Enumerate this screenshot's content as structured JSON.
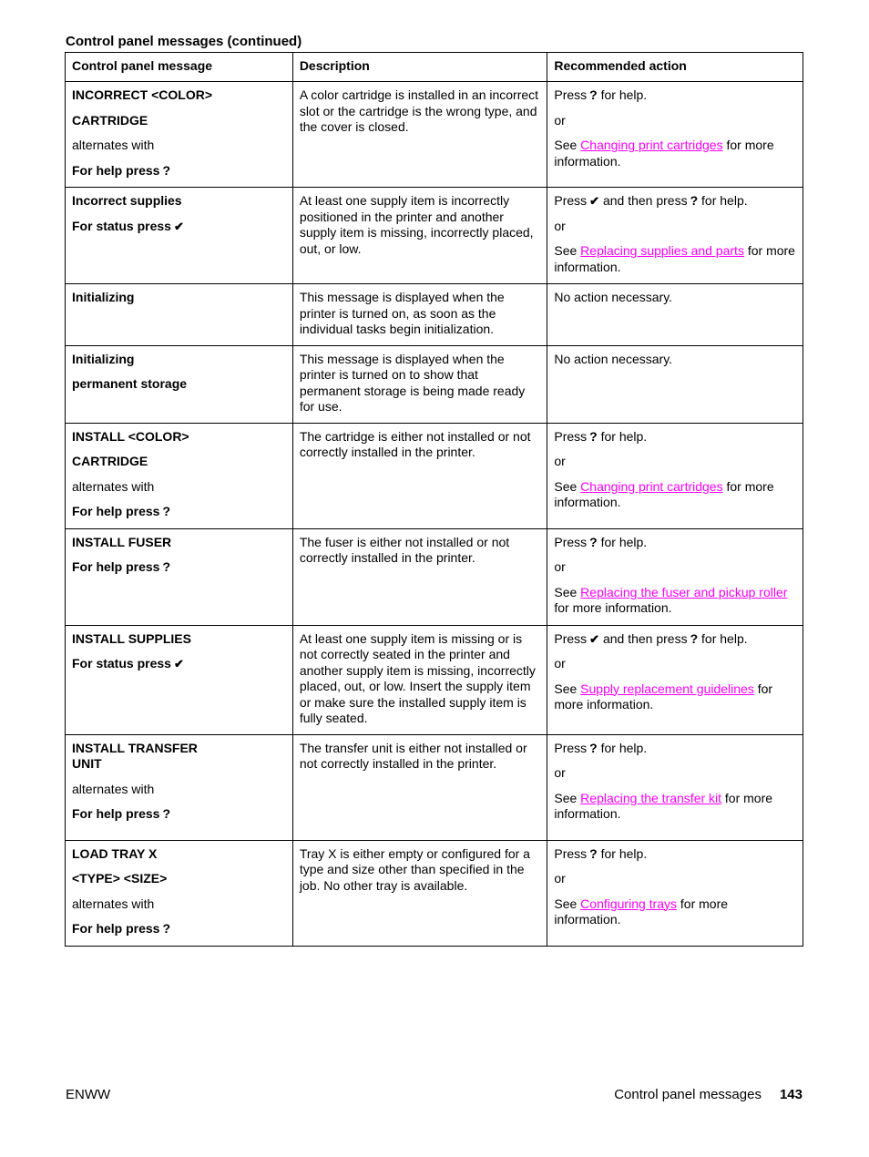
{
  "section_title": "Control panel messages (continued)",
  "table": {
    "headers": [
      "Control panel message",
      "Description",
      "Recommended action"
    ],
    "rows": [
      {
        "message": [
          "INCORRECT <COLOR>",
          "CARTRIDGE",
          "alternates with",
          "For help press"
        ],
        "description": "A color cartridge is installed in an incorrect slot or the cartridge is the wrong type, and the cover is closed.",
        "action": {
          "press_pre": "Press",
          "press_mid": "",
          "press_post": "for help.",
          "or": "or",
          "see": "See",
          "link": "Changing print cartridges",
          "after": "for more information."
        }
      },
      {
        "message": [
          "Incorrect supplies",
          "For status press"
        ],
        "description": "At least one supply item is incorrectly positioned in the printer and another supply item is missing, incorrectly placed, out, or low.",
        "action": {
          "press_pre": "Press",
          "press_mid": "and then press",
          "press_post": "for help.",
          "or": "or",
          "see": "See",
          "link": "Replacing supplies and parts",
          "after": "for more information."
        }
      },
      {
        "message": [
          "Initializing"
        ],
        "description": "This message is displayed when the printer is turned on, as soon as the individual tasks begin initialization.",
        "action": {
          "text": "No action necessary."
        }
      },
      {
        "message": [
          "Initializing",
          "permanent storage"
        ],
        "description": "This message is displayed when the printer is turned on to show that permanent storage is being made ready for use.",
        "action": {
          "text": "No action necessary."
        }
      },
      {
        "message": [
          "INSTALL <COLOR>",
          "CARTRIDGE",
          "alternates with",
          "For help press"
        ],
        "description": "The cartridge is either not installed or not correctly installed in the printer.",
        "action": {
          "press_pre": "Press",
          "press_post": "for help.",
          "or": "or",
          "see": "See",
          "link": "Changing print cartridges",
          "after": "for more information."
        }
      },
      {
        "message": [
          "INSTALL FUSER",
          "For help press"
        ],
        "description": "The fuser is either not installed or not correctly installed in the printer.",
        "action": {
          "press_pre": "Press",
          "press_post": "for help.",
          "or": "or",
          "see": "See",
          "link": "Replacing the fuser and pickup roller",
          "after": "for more information."
        }
      },
      {
        "message": [
          "INSTALL SUPPLIES",
          "For status press"
        ],
        "description": "At least one supply item is missing or is not correctly seated in the printer and another supply item is missing, incorrectly placed, out, or low. Insert the supply item or make sure the installed supply item is fully seated.",
        "action": {
          "press_pre": "Press",
          "press_mid": "and then press",
          "press_post": "for help.",
          "or": "or",
          "see": "See",
          "link": "Supply replacement guidelines",
          "after": "for more information."
        }
      },
      {
        "message": [
          "INSTALL TRANSFER UNIT",
          "alternates with",
          "For help press"
        ],
        "description": "The transfer unit is either not installed or not correctly installed in the printer.",
        "action": {
          "press_pre": "Press",
          "press_post": "for help.",
          "or": "or",
          "see": "See",
          "link": "Replacing the transfer kit",
          "after": "for more information."
        }
      },
      {
        "message": [
          "LOAD TRAY X",
          "<TYPE> <SIZE>",
          "alternates with",
          "For help press"
        ],
        "description": "Tray X is either empty or configured for a type and size other than specified in the job. No other tray is available.",
        "action": {
          "press_pre": "Press",
          "press_post": "for help.",
          "or": "or",
          "see": "See",
          "link": "Configuring trays",
          "after": "for more information."
        }
      }
    ]
  },
  "icons": {
    "help": "?",
    "check": "✔"
  },
  "footer": {
    "left": "ENWW",
    "section": "Control panel messages",
    "page": "143"
  },
  "colors": {
    "link": "#ff00ff"
  }
}
